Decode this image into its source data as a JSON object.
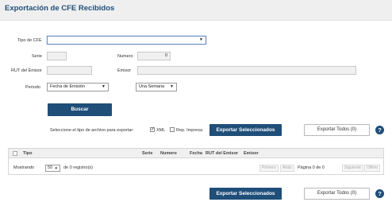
{
  "header": {
    "title": "Exportación de CFE Recibidos"
  },
  "form": {
    "tipo_cfe_label": "Tipo de CFE",
    "tipo_cfe_value": "",
    "serie_label": "Serie",
    "serie_value": "",
    "numero_label": "Numero",
    "numero_value": "0",
    "rut_label": "RUT del Emisor",
    "rut_value": "",
    "emisor_label": "Emisor",
    "emisor_value": "",
    "periodo_label": "Periodo",
    "periodo_tipo_value": "Fecha de Emisión",
    "periodo_rango_value": "Una Semana",
    "buscar_label": "Buscar"
  },
  "export": {
    "prompt_label": "Seleccione el tipo de archivo para exportar:",
    "xml_label": "XML",
    "xml_checked": true,
    "rep_impresa_label": "Rep. Impresa",
    "rep_impresa_checked": false,
    "exportar_seleccionados_label": "Exportar Seleccionados",
    "exportar_todos_label": "Exportar Todos (0)",
    "help_label": "?"
  },
  "table": {
    "columns": [
      "Tipo",
      "Serie",
      "Numero",
      "Fecha",
      "RUT del Emisor",
      "Emisor"
    ],
    "mostrando_label": "Mostrando",
    "page_size_value": "50",
    "range_text": "de  0  registro(s)",
    "pagina_text": "Página  0  de  0",
    "primero_label": "Primero",
    "atras_label": "Atrás",
    "siguiente_label": "Siguiente",
    "ultimo_label": "Último"
  },
  "colors": {
    "primary": "#1f4e79",
    "header_bg": "#efefef"
  }
}
